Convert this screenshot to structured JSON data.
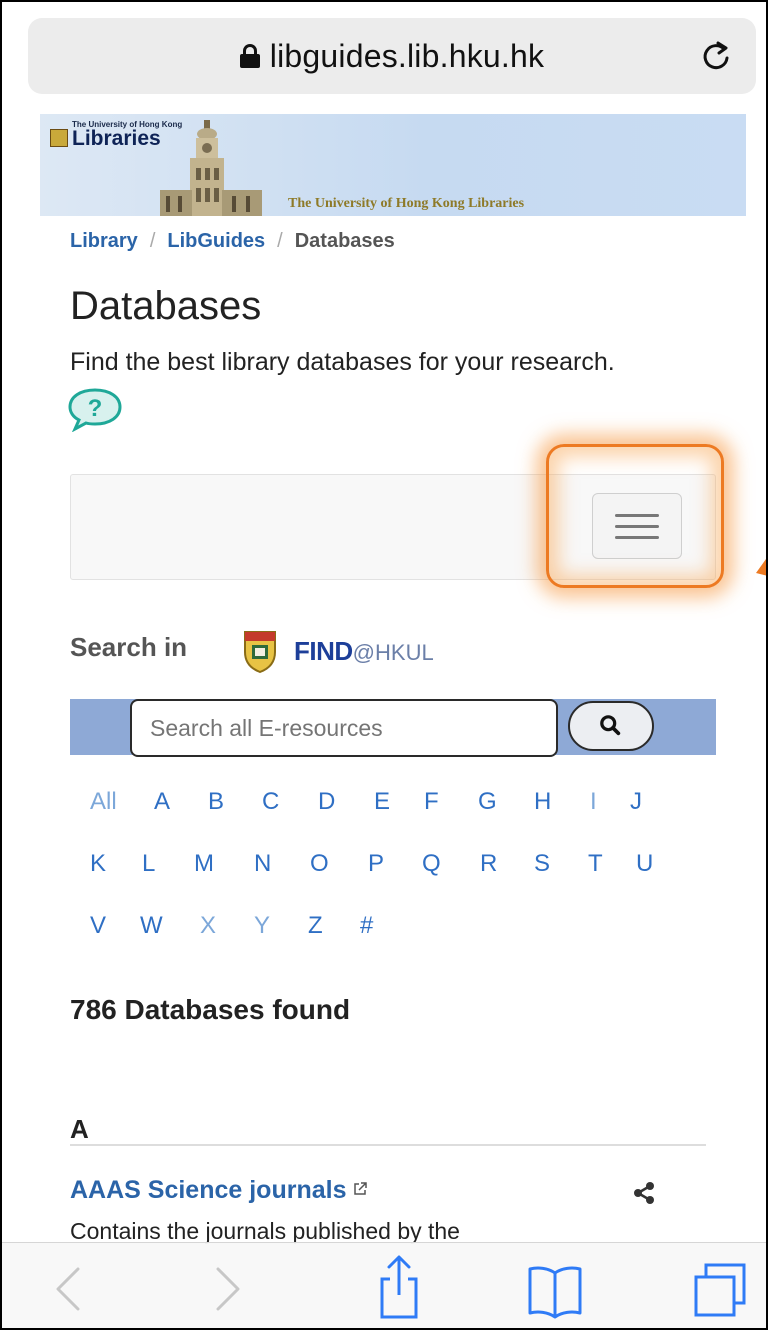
{
  "browser": {
    "url": "libguides.lib.hku.hk"
  },
  "banner": {
    "logo_small": "The University of Hong Kong",
    "logo_big": "Libraries",
    "caption": "The University of Hong Kong Libraries"
  },
  "breadcrumb": {
    "items": [
      "Library",
      "LibGuides",
      "Databases"
    ],
    "separator": "/"
  },
  "page": {
    "title": "Databases",
    "intro": "Find the best library databases for your research."
  },
  "search": {
    "label": "Search in",
    "find_main": "FIND",
    "find_suffix": "@HKUL",
    "placeholder": "Search all E-resources"
  },
  "alphabet": {
    "row1": [
      "All",
      "A",
      "B",
      "C",
      "D",
      "E",
      "F",
      "G",
      "H",
      "I",
      "J"
    ],
    "row2": [
      "K",
      "L",
      "M",
      "N",
      "O",
      "P",
      "Q",
      "R",
      "S",
      "T",
      "U"
    ],
    "row3": [
      "V",
      "W",
      "X",
      "Y",
      "Z",
      "#"
    ],
    "dimmed": [
      "All",
      "I",
      "X",
      "Y"
    ]
  },
  "results": {
    "count_text": "786 Databases found",
    "section_letter": "A",
    "first_db_title": "AAAS Science journals",
    "first_db_desc": "Contains the journals published by the"
  },
  "colors": {
    "link": "#2b64a8",
    "search_band": "#8ea9d6",
    "highlight": "#ed7a22"
  }
}
